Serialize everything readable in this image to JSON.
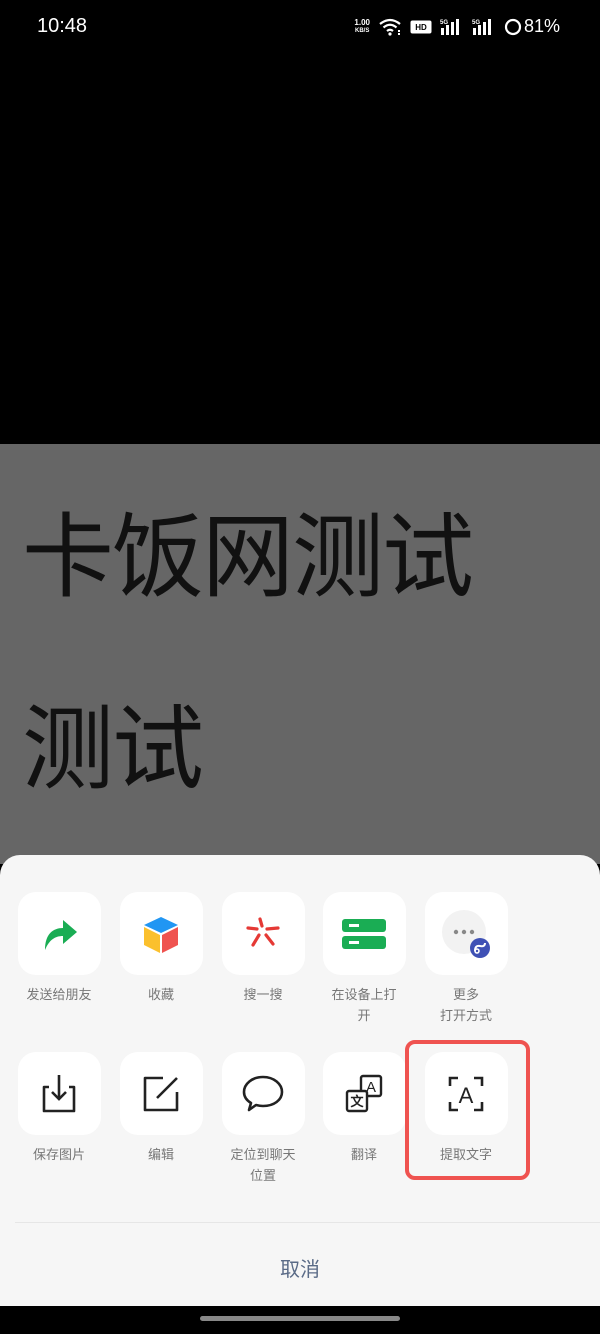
{
  "status_bar": {
    "time": "10:48",
    "net_speed_value": "1.00",
    "net_speed_unit": "KB/S",
    "battery_percent": "81%",
    "icons": [
      "net-speed-icon",
      "wifi-icon",
      "hd-icon",
      "signal-5g-icon",
      "signal-5g-icon",
      "battery-ring-icon"
    ]
  },
  "image_preview": {
    "line1": "卡饭网测试",
    "line2": "测试"
  },
  "share_sheet": {
    "row1": [
      {
        "label": "发送给朋友",
        "icon": "share-arrow-icon",
        "color": "#1aad54"
      },
      {
        "label": "收藏",
        "icon": "favorite-cube-icon",
        "color": "#2196f3"
      },
      {
        "label": "搜一搜",
        "icon": "search-star-icon",
        "color": "#e53935"
      },
      {
        "label": "在设备上打开",
        "icon": "open-on-device-icon",
        "color": "#1aad54"
      },
      {
        "label": "更多\n打开方式",
        "icon": "more-open-methods-icon",
        "color": "#3f51b5"
      }
    ],
    "row2": [
      {
        "label": "保存图片",
        "icon": "save-image-icon"
      },
      {
        "label": "编辑",
        "icon": "edit-icon"
      },
      {
        "label": "定位到聊天位置",
        "icon": "locate-chat-icon"
      },
      {
        "label": "翻译",
        "icon": "translate-icon"
      },
      {
        "label": "提取文字",
        "icon": "extract-text-icon",
        "highlighted": true
      }
    ],
    "highlight_color": "#ef5350",
    "cancel_label": "取消"
  }
}
